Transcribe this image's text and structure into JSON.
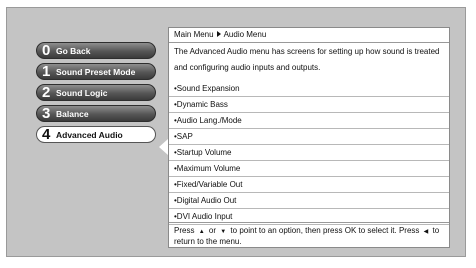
{
  "sidebar": {
    "items": [
      {
        "number": "0",
        "label": "Go Back"
      },
      {
        "number": "1",
        "label": "Sound Preset Mode"
      },
      {
        "number": "2",
        "label": "Sound Logic"
      },
      {
        "number": "3",
        "label": "Balance"
      },
      {
        "number": "4",
        "label": "Advanced Audio"
      }
    ],
    "selected_index": 4
  },
  "panel": {
    "breadcrumb": {
      "root": "Main Menu",
      "current": "Audio Menu"
    },
    "description": "The Advanced Audio menu has screens for setting up how sound is treated and configuring audio inputs and outputs.",
    "options": [
      "•Sound Expansion",
      "•Dynamic Bass",
      "•Audio Lang./Mode",
      "•SAP",
      "•Startup Volume",
      "•Maximum Volume",
      "•Fixed/Variable Out",
      "•Digital Audio Out",
      "•DVI Audio Input"
    ],
    "footer": {
      "part1": "Press",
      "up_glyph": "▲",
      "part2": "or",
      "down_glyph": "▼",
      "part3": "to point to an option, then press OK to select it. Press",
      "left_glyph": "◀",
      "part4": "to return to the menu."
    }
  },
  "icons": {
    "breadcrumb_separator": "arrow-right-icon",
    "pointer": "pointer-left-icon"
  },
  "colors": {
    "screen_background": "#c4c4c4",
    "button_dark": "#565656",
    "button_selected": "#ffffff",
    "panel_background": "#ffffff"
  }
}
